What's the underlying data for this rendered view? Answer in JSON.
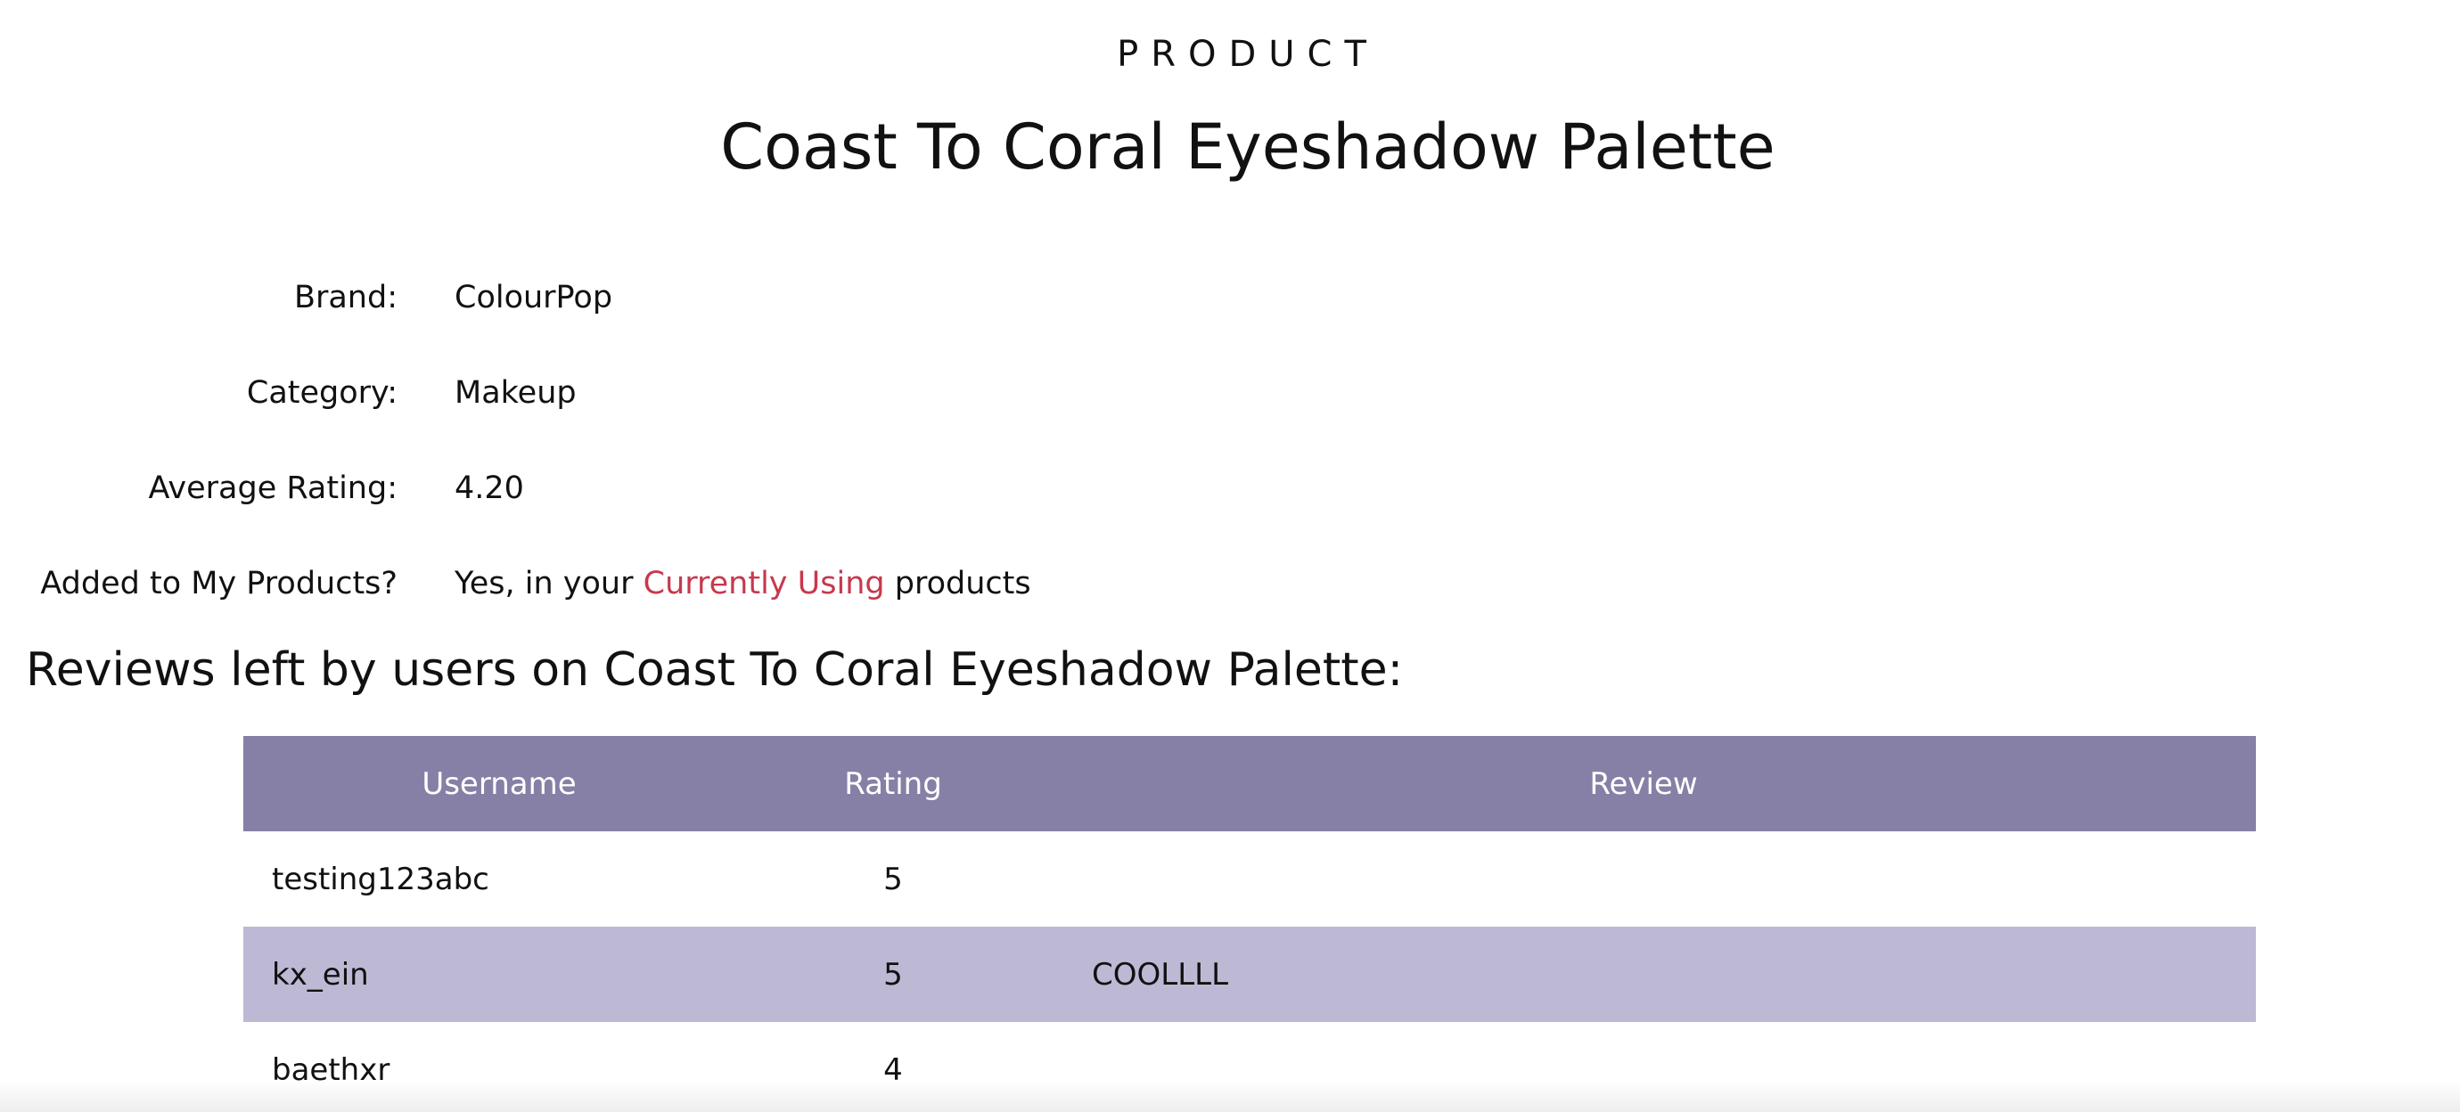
{
  "header": {
    "eyebrow": "PRODUCT",
    "title": "Coast To Coral Eyeshadow Palette"
  },
  "details": {
    "brand_label": "Brand:",
    "brand_value": "ColourPop",
    "category_label": "Category:",
    "category_value": "Makeup",
    "rating_label": "Average Rating:",
    "rating_value": "4.20",
    "added_label": "Added to My Products?",
    "added_prefix": "Yes, in your",
    "added_link": "Currently Using",
    "added_suffix": "products"
  },
  "reviews": {
    "heading": "Reviews left by users on Coast To Coral Eyeshadow Palette:",
    "columns": [
      "Username",
      "Rating",
      "Review"
    ],
    "rows": [
      {
        "username": "testing123abc",
        "rating": "5",
        "review": ""
      },
      {
        "username": "kx_ein",
        "rating": "5",
        "review": "COOLLLL"
      },
      {
        "username": "baethxr",
        "rating": "4",
        "review": ""
      }
    ]
  },
  "colors": {
    "table_header": "#8680a6",
    "row_alt": "#bdb9d5",
    "link_accent": "#c6394d"
  }
}
